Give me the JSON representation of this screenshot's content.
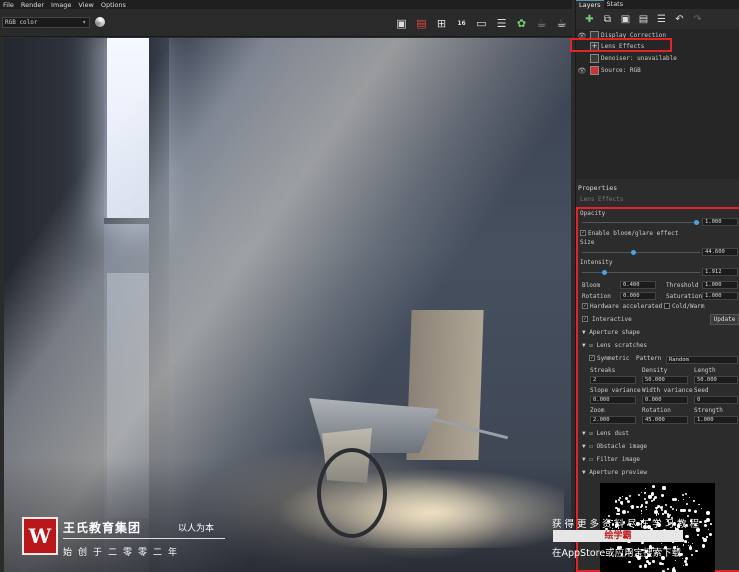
{
  "menubar": {
    "items": [
      "File",
      "Render",
      "Image",
      "View",
      "Options"
    ]
  },
  "toolbar": {
    "channel_select": "RGB color",
    "icons": [
      "save-icon",
      "save-as-icon",
      "region-render-icon",
      "toggle-16bit-icon",
      "display-icon",
      "history-icon",
      "lens-effects-icon",
      "teapot-icon",
      "teapot-outline-icon"
    ]
  },
  "watermark": {
    "logo": "W",
    "title": "王氏教育集团",
    "slogan": "以人为本",
    "subtitle": "始创于二零零二年"
  },
  "panel": {
    "tabs": [
      "Layers",
      "Stats"
    ],
    "layers": [
      {
        "name": "Display Correction",
        "visible": true
      },
      {
        "name": "Lens Effects",
        "visible": false,
        "selected": true
      },
      {
        "name": "Denoiser: unavailable",
        "visible": false
      },
      {
        "name": "Source: RGB",
        "visible": true
      }
    ],
    "properties_title": "Properties",
    "properties_subtitle": "Lens Effects",
    "opacity_label": "Opacity",
    "opacity_value": "1.000",
    "enable_bloom_label": "Enable bloom/glare effect",
    "size_label": "Size",
    "size_value": "44.600",
    "intensity_label": "Intensity",
    "intensity_value": "1.912",
    "bloom_label": "Bloom",
    "bloom_value": "0.400",
    "threshold_label": "Threshold",
    "threshold_value": "1.000",
    "rotation_label": "Rotation",
    "rotation_value": "0.000",
    "saturation_label": "Saturation",
    "saturation_value": "1.000",
    "hw_accel_label": "Hardware accelerated",
    "coldwarm_label": "Cold/Warm",
    "interactive_label": "Interactive",
    "update_label": "Update",
    "aperture_shape_label": "Aperture shape",
    "lens_scratches_label": "Lens scratches",
    "symmetric_label": "Symmetric",
    "pattern_label": "Pattern",
    "pattern_value": "Random",
    "streaks_label": "Streaks",
    "density_label": "Density",
    "length_label": "Length",
    "streaks_value": "2",
    "density_value": "50.000",
    "length_value": "50.000",
    "slope_var_label": "Slope variance",
    "width_var_label": "Width variance",
    "seed_label": "Seed",
    "slope_var_value": "0.000",
    "width_var_value": "0.000",
    "seed_value": "0",
    "zoom_label": "Zoom",
    "rot2_label": "Rotation",
    "strength_label": "Strength",
    "zoom_value": "2.000",
    "rot2_value": "45.000",
    "strength_value": "1.000",
    "lens_dust_label": "Lens dust",
    "obstacle_label": "Obstacle image",
    "filter_label": "Filter image",
    "aperture_preview_label": "Aperture preview"
  },
  "ad": {
    "line1": "获得更多资料尽在学习教程",
    "banner": "绘学霸",
    "line2": "在AppStore或应用宝搜索下载"
  }
}
